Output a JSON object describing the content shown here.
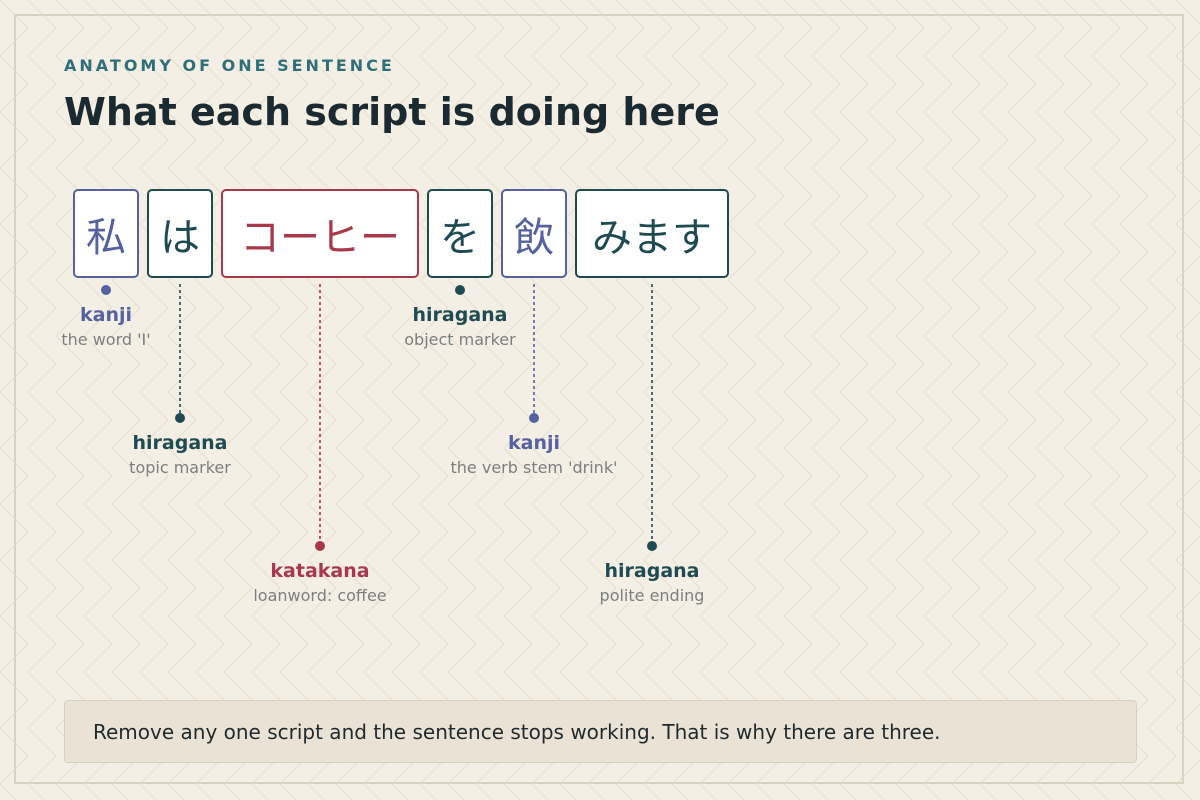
{
  "header": {
    "kicker": "ANATOMY OF ONE SENTENCE",
    "title": "What each script is doing here"
  },
  "colors": {
    "kanji": "#5661a0",
    "hiragana": "#1e4a52",
    "katakana": "#a8394a",
    "background": "#f4efe4"
  },
  "segments": [
    {
      "text": "私",
      "script": "kanji",
      "label": "kanji",
      "desc": "the word 'I'"
    },
    {
      "text": "は",
      "script": "hiragana",
      "label": "hiragana",
      "desc": "topic marker"
    },
    {
      "text": "コーヒー",
      "script": "katakana",
      "label": "katakana",
      "desc": "loanword: coffee"
    },
    {
      "text": "を",
      "script": "hiragana",
      "label": "hiragana",
      "desc": "object marker"
    },
    {
      "text": "飲",
      "script": "kanji",
      "label": "kanji",
      "desc": "the verb stem 'drink'"
    },
    {
      "text": "みます",
      "script": "hiragana",
      "label": "hiragana",
      "desc": "polite ending"
    }
  ],
  "footer": {
    "note": "Remove any one script and the sentence stops working. That is why there are three."
  }
}
